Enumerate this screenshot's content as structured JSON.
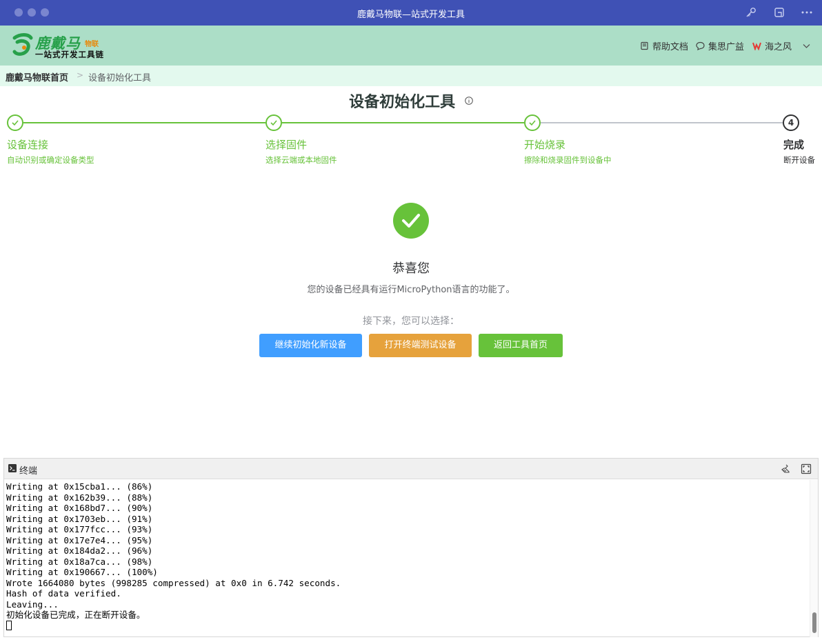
{
  "window": {
    "title": "鹿戴马物联—站式开发工具"
  },
  "logo": {
    "main": "鹿戴马",
    "badge": "物联",
    "sub": "一站式开发工具链"
  },
  "nav": {
    "help": "帮助文档",
    "community": "集思广益",
    "user": "海之风"
  },
  "breadcrumb": {
    "home": "鹿戴马物联首页",
    "separator": ">",
    "current": "设备初始化工具"
  },
  "page": {
    "title": "设备初始化工具"
  },
  "steps": [
    {
      "title": "设备连接",
      "desc": "自动识别或确定设备类型",
      "status": "done"
    },
    {
      "title": "选择固件",
      "desc": "选择云端或本地固件",
      "status": "done"
    },
    {
      "title": "开始烧录",
      "desc": "擦除和烧录固件到设备中",
      "status": "done"
    },
    {
      "title": "完成",
      "desc": "断开设备",
      "status": "current",
      "number": "4"
    }
  ],
  "result": {
    "title": "恭喜您",
    "subtitle": "您的设备已经具有运行MicroPython语言的功能了。",
    "next_label": "接下来，您可以选择："
  },
  "actions": {
    "continue": "继续初始化新设备",
    "open_terminal": "打开终端测试设备",
    "back_home": "返回工具首页"
  },
  "terminal": {
    "title": "终端",
    "lines": [
      "Writing at 0x15cba1... (86%)",
      "Writing at 0x162b39... (88%)",
      "Writing at 0x168bd7... (90%)",
      "Writing at 0x1703eb... (91%)",
      "Writing at 0x177fcc... (93%)",
      "Writing at 0x17e7e4... (95%)",
      "Writing at 0x184da2... (96%)",
      "Writing at 0x18a7ca... (98%)",
      "Writing at 0x190667... (100%)",
      "Wrote 1664080 bytes (998285 compressed) at 0x0 in 6.742 seconds.",
      "Hash of data verified.",
      "Leaving...",
      "初始化设备已完成，正在断开设备。"
    ]
  },
  "colors": {
    "titlebar": "#3f51b5",
    "header": "#acdec7",
    "breadcrumb_bg": "#e3f9ee",
    "success": "#67c23a",
    "primary": "#409eff",
    "warning": "#e6a23c"
  }
}
